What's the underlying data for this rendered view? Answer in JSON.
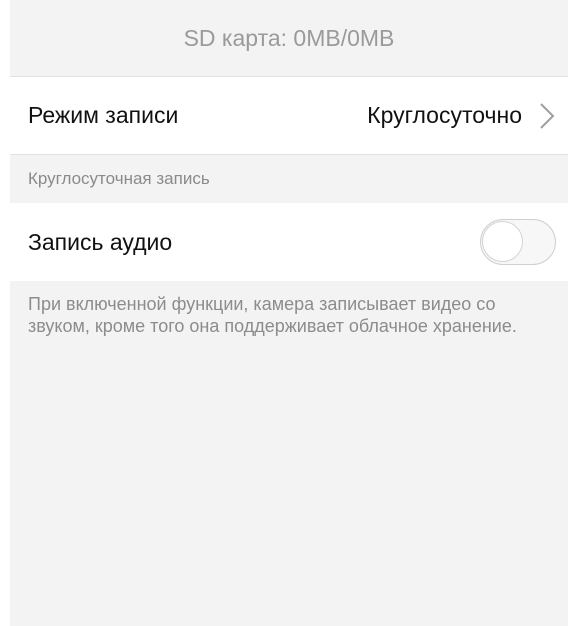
{
  "sd_card": {
    "status_text": "SD карта: 0MB/0MB"
  },
  "recording_mode": {
    "label": "Режим записи",
    "value": "Круглосуточно",
    "chevron_icon": "chevron-right-icon"
  },
  "section": {
    "label": "Круглосуточная запись"
  },
  "audio_recording": {
    "label": "Запись аудио",
    "enabled": false
  },
  "description": {
    "text": "При включенной функции, камера записывает видео со звуком, кроме того она поддерживает облачное хранение."
  }
}
